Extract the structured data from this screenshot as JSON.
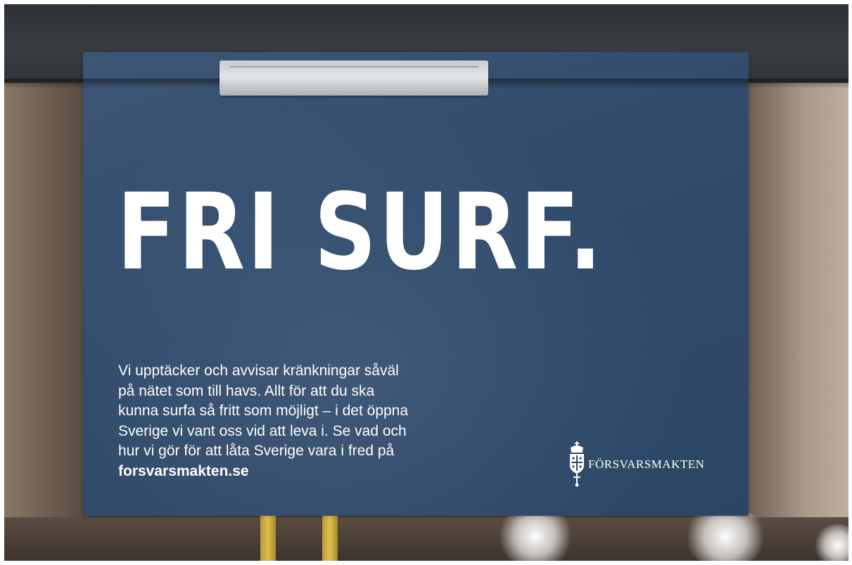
{
  "poster": {
    "headline": "FRI SURF.",
    "body_lines": [
      "Vi upptäcker och avvisar kränkningar såväl",
      "på nätet som till havs. Allt för att du ska",
      "kunna surfa så fritt som möjligt – i det öppna",
      "Sverige vi vant oss vid att leva i. Se vad och",
      "hur vi gör för att låta Sverige vara i fred på"
    ],
    "url": "forsvarsmakten.se",
    "logo_text": "FÖRSVARSMAKTEN",
    "logo_icon": "crown-shield-sword-crest-icon"
  },
  "colors": {
    "poster_blue": "#2f4a6b",
    "text": "#ffffff",
    "frame": "#33373a"
  }
}
